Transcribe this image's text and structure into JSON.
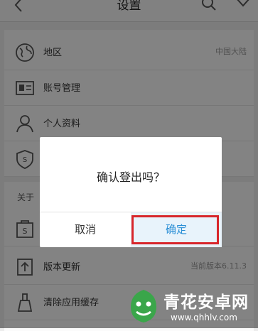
{
  "header": {
    "title": "设置"
  },
  "settings": {
    "region": {
      "label": "地区",
      "value": "中国大陆"
    },
    "account": {
      "label": "账号管理"
    },
    "profile": {
      "label": "个人资料"
    },
    "about_section": {
      "label": "关于"
    },
    "version_update": {
      "label": "版本更新",
      "value": "当前版本6.11.3"
    },
    "clear_cache": {
      "label": "清除应用缓存"
    }
  },
  "dialog": {
    "message": "确认登出吗？",
    "cancel_label": "取消",
    "confirm_label": "确定"
  },
  "watermark": {
    "name": "青花安卓网",
    "url": "www.qhhlv.com"
  },
  "colors": {
    "accent": "#2a8fd6",
    "highlight": "#d8262b",
    "leaf": "#3aa64a"
  }
}
